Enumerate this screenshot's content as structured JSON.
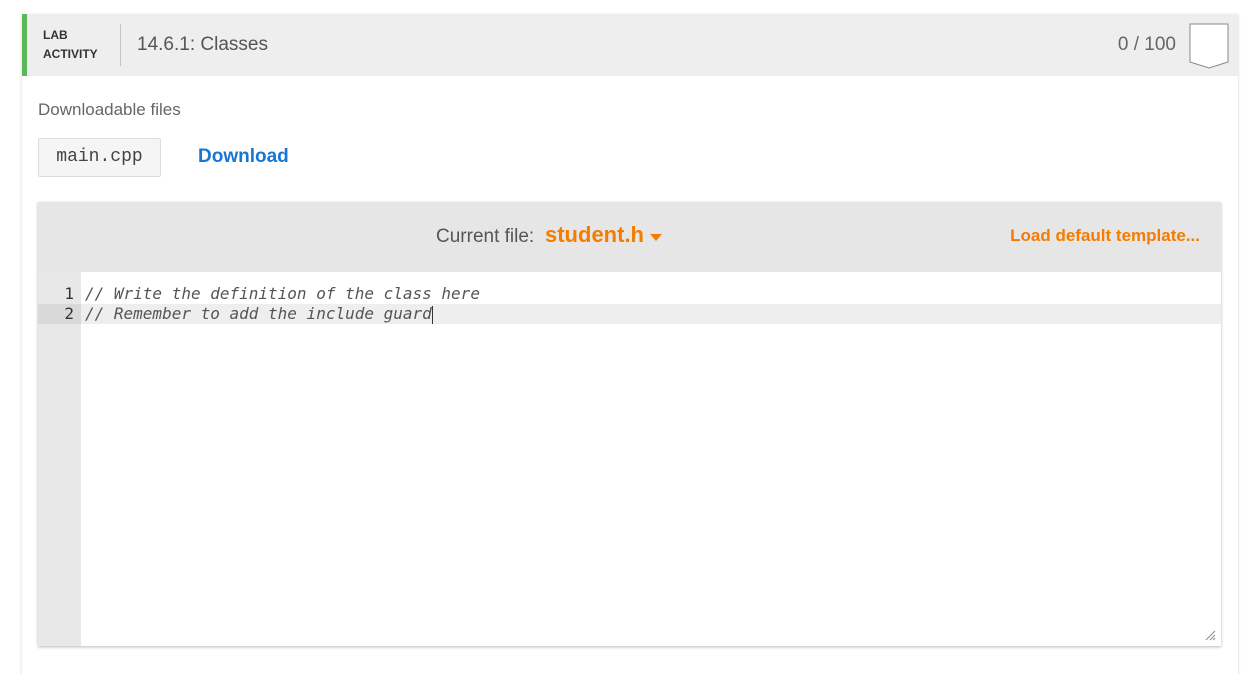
{
  "header": {
    "badge_line1": "LAB",
    "badge_line2": "ACTIVITY",
    "title": "14.6.1: Classes",
    "score": "0 / 100",
    "accent": "#5cb85c"
  },
  "downloads": {
    "title": "Downloadable files",
    "file_name": "main.cpp",
    "download_label": "Download"
  },
  "editor": {
    "current_file_label": "Current file:",
    "current_file": "student.h",
    "load_template_label": "Load default template...",
    "accent": "#f57c00",
    "lines": [
      {
        "num": "1",
        "text": "// Write the definition of the class here"
      },
      {
        "num": "2",
        "text": "// Remember to add the include guard"
      }
    ]
  }
}
